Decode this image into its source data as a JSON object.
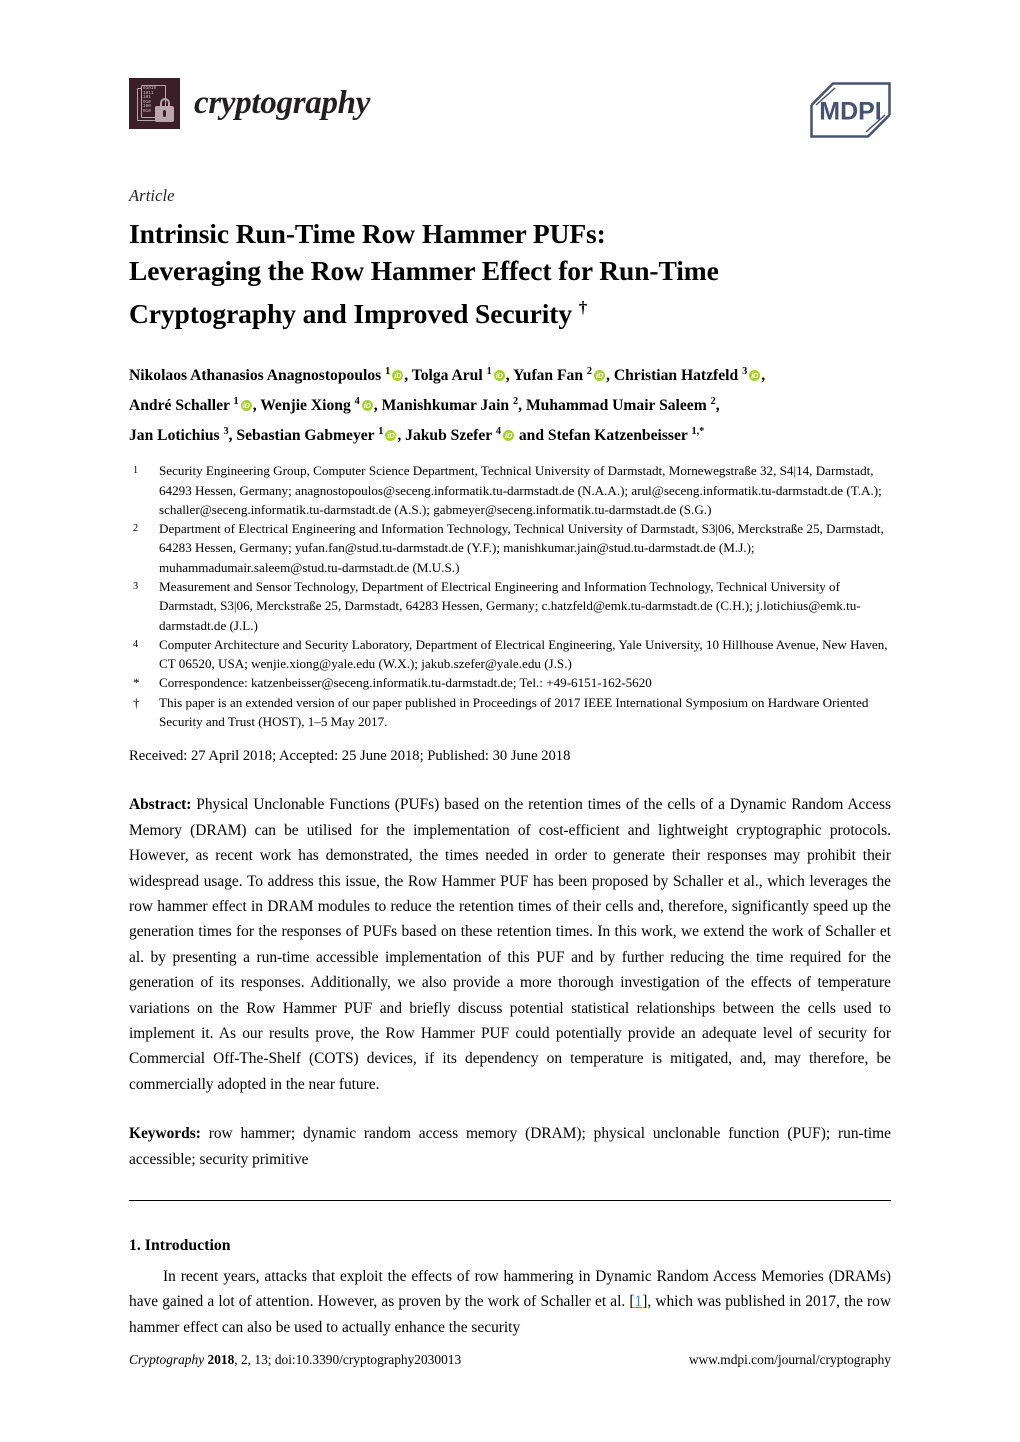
{
  "journal": {
    "name": "cryptography",
    "logo_icon": "lock-book-icon",
    "publisher_logo": "mdpi-logo",
    "publisher_name": "MDPI"
  },
  "article_type": "Article",
  "title_lines": [
    "Intrinsic Run-Time Row Hammer PUFs:",
    "Leveraging the Row Hammer Effect for Run-Time",
    "Cryptography and Improved Security "
  ],
  "title_dagger": "†",
  "authors_lines": [
    [
      {
        "name": "Nikolaos Athanasios Anagnostopoulos",
        "sup": "1",
        "orcid": true,
        "sep": ", "
      },
      {
        "name": "Tolga Arul",
        "sup": "1",
        "orcid": true,
        "sep": ", "
      },
      {
        "name": "Yufan Fan",
        "sup": "2",
        "orcid": true,
        "sep": ", "
      },
      {
        "name": "Christian Hatzfeld",
        "sup": "3",
        "orcid": true,
        "sep": ","
      }
    ],
    [
      {
        "name": "André Schaller",
        "sup": "1",
        "orcid": true,
        "sep": ", "
      },
      {
        "name": "Wenjie Xiong",
        "sup": "4",
        "orcid": true,
        "sep": ", "
      },
      {
        "name": "Manishkumar Jain",
        "sup": "2",
        "orcid": false,
        "sep": ", "
      },
      {
        "name": "Muhammad Umair Saleem",
        "sup": "2",
        "orcid": false,
        "sep": ","
      }
    ],
    [
      {
        "name": "Jan Lotichius",
        "sup": "3",
        "orcid": false,
        "sep": ", "
      },
      {
        "name": "Sebastian Gabmeyer",
        "sup": "1",
        "orcid": true,
        "sep": ", "
      },
      {
        "name": "Jakub Szefer",
        "sup": "4",
        "orcid": true,
        "sep": " and "
      },
      {
        "name": "Stefan Katzenbeisser",
        "sup": "1,*",
        "orcid": false,
        "sep": ""
      }
    ]
  ],
  "affiliations": [
    {
      "marker": "1",
      "text": "Security Engineering Group, Computer Science Department, Technical University of Darmstadt, Mornewegstraße 32, S4|14, Darmstadt, 64293 Hessen, Germany; anagnostopoulos@seceng.informatik.tu-darmstadt.de (N.A.A.); arul@seceng.informatik.tu-darmstadt.de (T.A.); schaller@seceng.informatik.tu-darmstadt.de (A.S.); gabmeyer@seceng.informatik.tu-darmstadt.de (S.G.)"
    },
    {
      "marker": "2",
      "text": "Department of Electrical Engineering and Information Technology, Technical University of Darmstadt, S3|06, Merckstraße 25, Darmstadt, 64283 Hessen, Germany; yufan.fan@stud.tu-darmstadt.de (Y.F.); manishkumar.jain@stud.tu-darmstadt.de (M.J.); muhammadumair.saleem@stud.tu-darmstadt.de (M.U.S.)"
    },
    {
      "marker": "3",
      "text": "Measurement and Sensor Technology, Department of Electrical Engineering and Information Technology, Technical University of Darmstadt, S3|06, Merckstraße 25, Darmstadt, 64283 Hessen, Germany; c.hatzfeld@emk.tu-darmstadt.de (C.H.); j.lotichius@emk.tu-darmstadt.de (J.L.)"
    },
    {
      "marker": "4",
      "text": "Computer Architecture and Security Laboratory, Department of Electrical Engineering, Yale University, 10 Hillhouse Avenue, New Haven, CT 06520, USA; wenjie.xiong@yale.edu (W.X.); jakub.szefer@yale.edu (J.S.)"
    },
    {
      "marker": "*",
      "text": "Correspondence: katzenbeisser@seceng.informatik.tu-darmstadt.de; Tel.: +49-6151-162-5620"
    },
    {
      "marker": "†",
      "text": "This paper is an extended version of our paper published in Proceedings of 2017 IEEE International Symposium on Hardware Oriented Security and Trust (HOST), 1–5 May 2017."
    }
  ],
  "dates": "Received: 27 April 2018; Accepted: 25 June 2018; Published: 30 June 2018",
  "abstract": {
    "label": "Abstract:",
    "text": " Physical Unclonable Functions (PUFs) based on the retention times of the cells of a Dynamic Random Access Memory (DRAM) can be utilised for the implementation of cost-efficient and lightweight cryptographic protocols. However, as recent work has demonstrated, the times needed in order to generate their responses may prohibit their widespread usage. To address this issue, the Row Hammer PUF has been proposed by Schaller et al., which leverages the row hammer effect in DRAM modules to reduce the retention times of their cells and, therefore, significantly speed up the generation times for the responses of PUFs based on these retention times. In this work, we extend the work of Schaller et al. by presenting a run-time accessible implementation of this PUF and by further reducing the time required for the generation of its responses. Additionally, we also provide a more thorough investigation of the effects of temperature variations on the Row Hammer PUF and briefly discuss potential statistical relationships between the cells used to implement it. As our results prove, the Row Hammer PUF could potentially provide an adequate level of security for Commercial Off-The-Shelf (COTS) devices, if its dependency on temperature is mitigated, and, may therefore, be commercially adopted in the near future."
  },
  "keywords": {
    "label": "Keywords:",
    "text": " row hammer; dynamic random access memory (DRAM); physical unclonable function (PUF); run-time accessible; security primitive"
  },
  "section": {
    "heading": "1. Introduction",
    "paragraph_part1": "In recent years, attacks that exploit the effects of row hammering in Dynamic Random Access Memories (DRAMs) have gained a lot of attention. However, as proven by the work of Schaller et al. [",
    "citation": "1",
    "paragraph_part2": "], which was published in 2017, the row hammer effect can also be used to actually enhance the security"
  },
  "footer": {
    "journal_italic": "Cryptography",
    "year": "2018",
    "reference": ", 2, 13; doi:10.3390/cryptography2030013",
    "url": "www.mdpi.com/journal/cryptography"
  },
  "colors": {
    "logo_background": "#3b1f28",
    "logo_foreground": "#b9a7ad",
    "mdpi_blue": "#455273",
    "orcid_green": "#a6ce39",
    "citation_blue": "#3a94c7"
  },
  "binary_rows": [
    "01010",
    "1011",
    "101",
    "010",
    "100",
    "010"
  ]
}
